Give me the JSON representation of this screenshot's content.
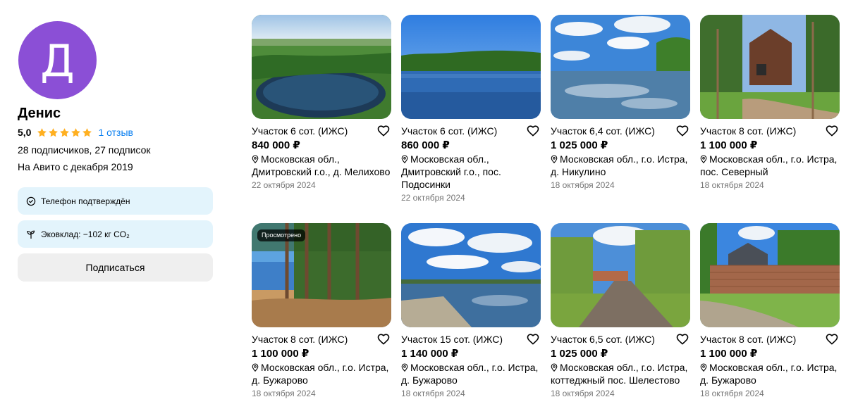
{
  "profile": {
    "avatar_letter": "Д",
    "avatar_color": "#8b4fd6",
    "name": "Денис",
    "rating": "5,0",
    "stars": 5,
    "reviews_link": "1 отзыв",
    "followers": "28 подписчиков, 27 подписок",
    "since": "На Авито с декабря 2019",
    "phone_badge": "Телефон подтверждён",
    "eco_badge": "Эковклад: −102 кг CO₂",
    "subscribe_label": "Подписаться"
  },
  "colors": {
    "accent_link": "#0a7ff0",
    "star": "#ffb021",
    "badge_bg": "#e3f4fc",
    "button_bg": "#efefef"
  },
  "listings": [
    {
      "title": "Участок 6 сот. (ИЖС)",
      "price": "840 000 ₽",
      "address": "Московская обл., Дмитровский г.о., д. Мелихово",
      "date": "22 октября 2024",
      "viewed": "",
      "scene": "lake-aerial"
    },
    {
      "title": "Участок 6 сот. (ИЖС)",
      "price": "860 000 ₽",
      "address": "Московская обл., Дмитровский г.о., пос. Подосинки",
      "date": "22 октября 2024",
      "viewed": "",
      "scene": "lake-forest"
    },
    {
      "title": "Участок 6,4 сот. (ИЖС)",
      "price": "1 025 000 ₽",
      "address": "Московская обл., г.о. Истра, д. Никулино",
      "date": "18 октября 2024",
      "viewed": "",
      "scene": "lake-clouds"
    },
    {
      "title": "Участок 8 сот. (ИЖС)",
      "price": "1 100 000 ₽",
      "address": "Московская обл., г.о. Истра, пос. Северный",
      "date": "18 октября 2024",
      "viewed": "",
      "scene": "pines-house"
    },
    {
      "title": "Участок 8 сот. (ИЖС)",
      "price": "1 100 000 ₽",
      "address": "Московская обл., г.о. Истра, д. Бужарово",
      "date": "18 октября 2024",
      "viewed": "Просмотрено",
      "scene": "shore-pines"
    },
    {
      "title": "Участок 15 сот. (ИЖС)",
      "price": "1 140 000 ₽",
      "address": "Московская обл., г.о. Истра, д. Бужарово",
      "date": "18 октября 2024",
      "viewed": "",
      "scene": "lake-pier"
    },
    {
      "title": "Участок 6,5 сот. (ИЖС)",
      "price": "1 025 000 ₽",
      "address": "Московская обл., г.о. Истра, коттеджный пос. Шелестово",
      "date": "18 октября 2024",
      "viewed": "",
      "scene": "country-road"
    },
    {
      "title": "Участок 8 сот. (ИЖС)",
      "price": "1 100 000 ₽",
      "address": "Московская обл., г.о. Истра, д. Бужарово",
      "date": "18 октября 2024",
      "viewed": "",
      "scene": "fence-house"
    }
  ]
}
